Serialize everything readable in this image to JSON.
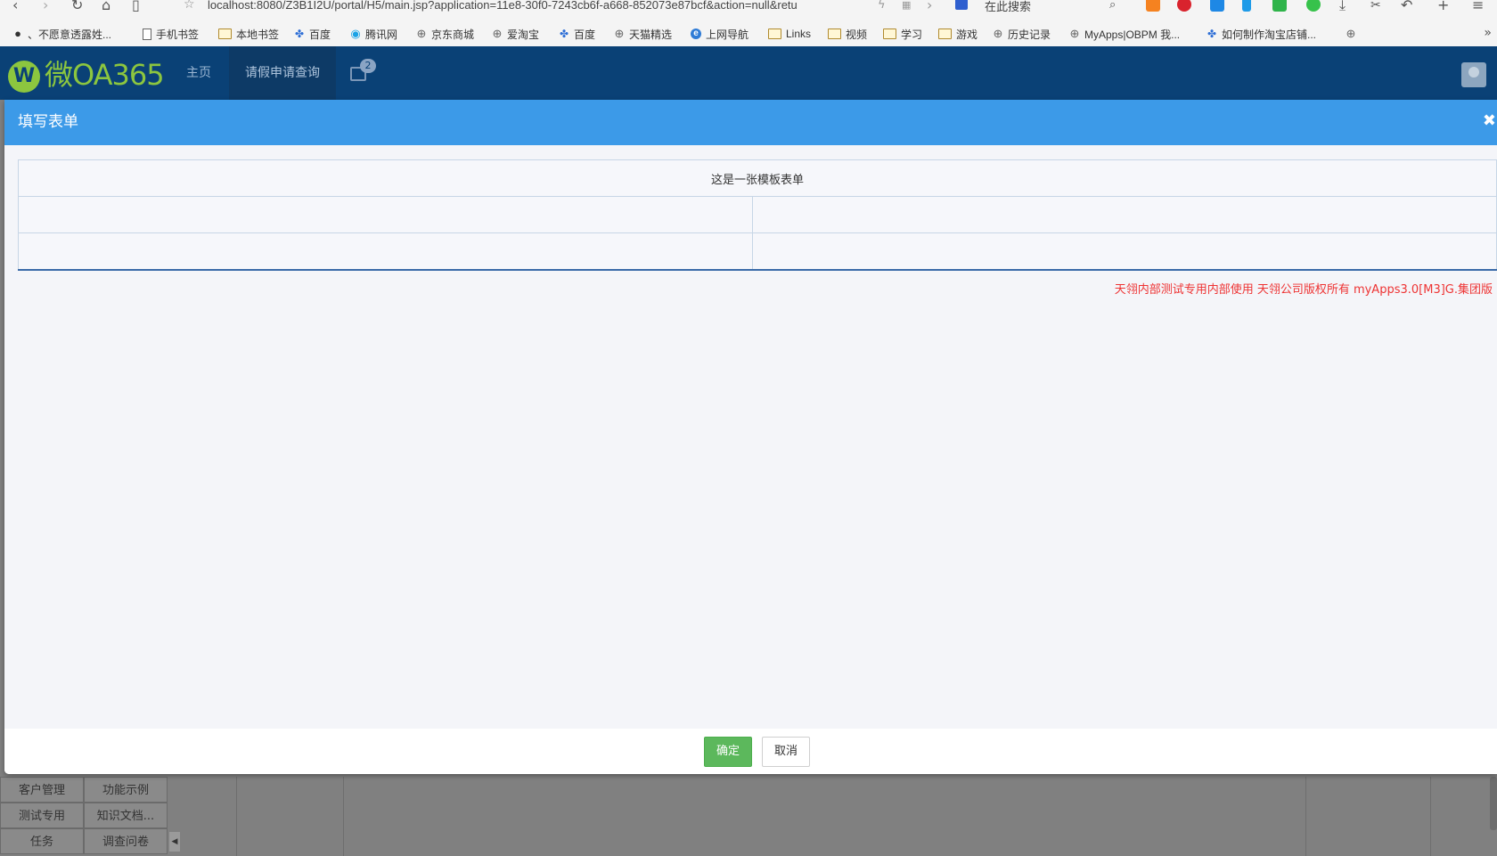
{
  "browser": {
    "url": "localhost:8080/Z3B1I2U/portal/H5/main.jsp?application=11e8-30f0-7243cb6f-a668-852073e87bcf&action=null&retu",
    "search_placeholder": "在此搜索",
    "bookmarks": [
      {
        "label": "、不愿意透露姓...",
        "icon": "avatar-icon"
      },
      {
        "label": "手机书签",
        "icon": "page-icon"
      },
      {
        "label": "本地书签",
        "icon": "folder-icon"
      },
      {
        "label": "百度",
        "icon": "paw-icon"
      },
      {
        "label": "腾讯网",
        "icon": "swirl-icon"
      },
      {
        "label": "京东商城",
        "icon": "globe-icon"
      },
      {
        "label": "爱淘宝",
        "icon": "globe-icon"
      },
      {
        "label": "百度",
        "icon": "paw-icon"
      },
      {
        "label": "天猫精选",
        "icon": "globe-icon"
      },
      {
        "label": "上网导航",
        "icon": "ie-icon"
      },
      {
        "label": "Links",
        "icon": "folder-icon"
      },
      {
        "label": "视频",
        "icon": "folder-icon"
      },
      {
        "label": "学习",
        "icon": "folder-icon"
      },
      {
        "label": "游戏",
        "icon": "folder-icon"
      },
      {
        "label": "历史记录",
        "icon": "globe-icon"
      },
      {
        "label": "MyApps|OBPM 我...",
        "icon": "globe-icon"
      },
      {
        "label": "如何制作淘宝店铺...",
        "icon": "paw-icon"
      },
      {
        "label": "",
        "icon": "globe-icon"
      }
    ]
  },
  "app": {
    "logo_letter": "W",
    "logo_text": "微OA365",
    "tabs": {
      "home": "主页",
      "leave_query": "请假申请查询"
    },
    "window_count": "2"
  },
  "modal": {
    "title": "填写表单",
    "close_glyph": "✖",
    "form_title": "这是一张模板表单",
    "copyright": "天翎内部测试专用内部使用 天翎公司版权所有 myApps3.0[M3]G.集团版",
    "ok_label": "确定",
    "cancel_label": "取消"
  },
  "background_menu": [
    [
      "客户管理",
      "功能示例"
    ],
    [
      "测试专用",
      "知识文档..."
    ],
    [
      "任务",
      "调查问卷"
    ]
  ],
  "colors": {
    "header_bg": "#0a4176",
    "modal_header_bg": "#3c9ae8",
    "ok_button": "#5cb85c",
    "copyright_text": "#ee3333",
    "logo_green": "#8cc63f"
  }
}
